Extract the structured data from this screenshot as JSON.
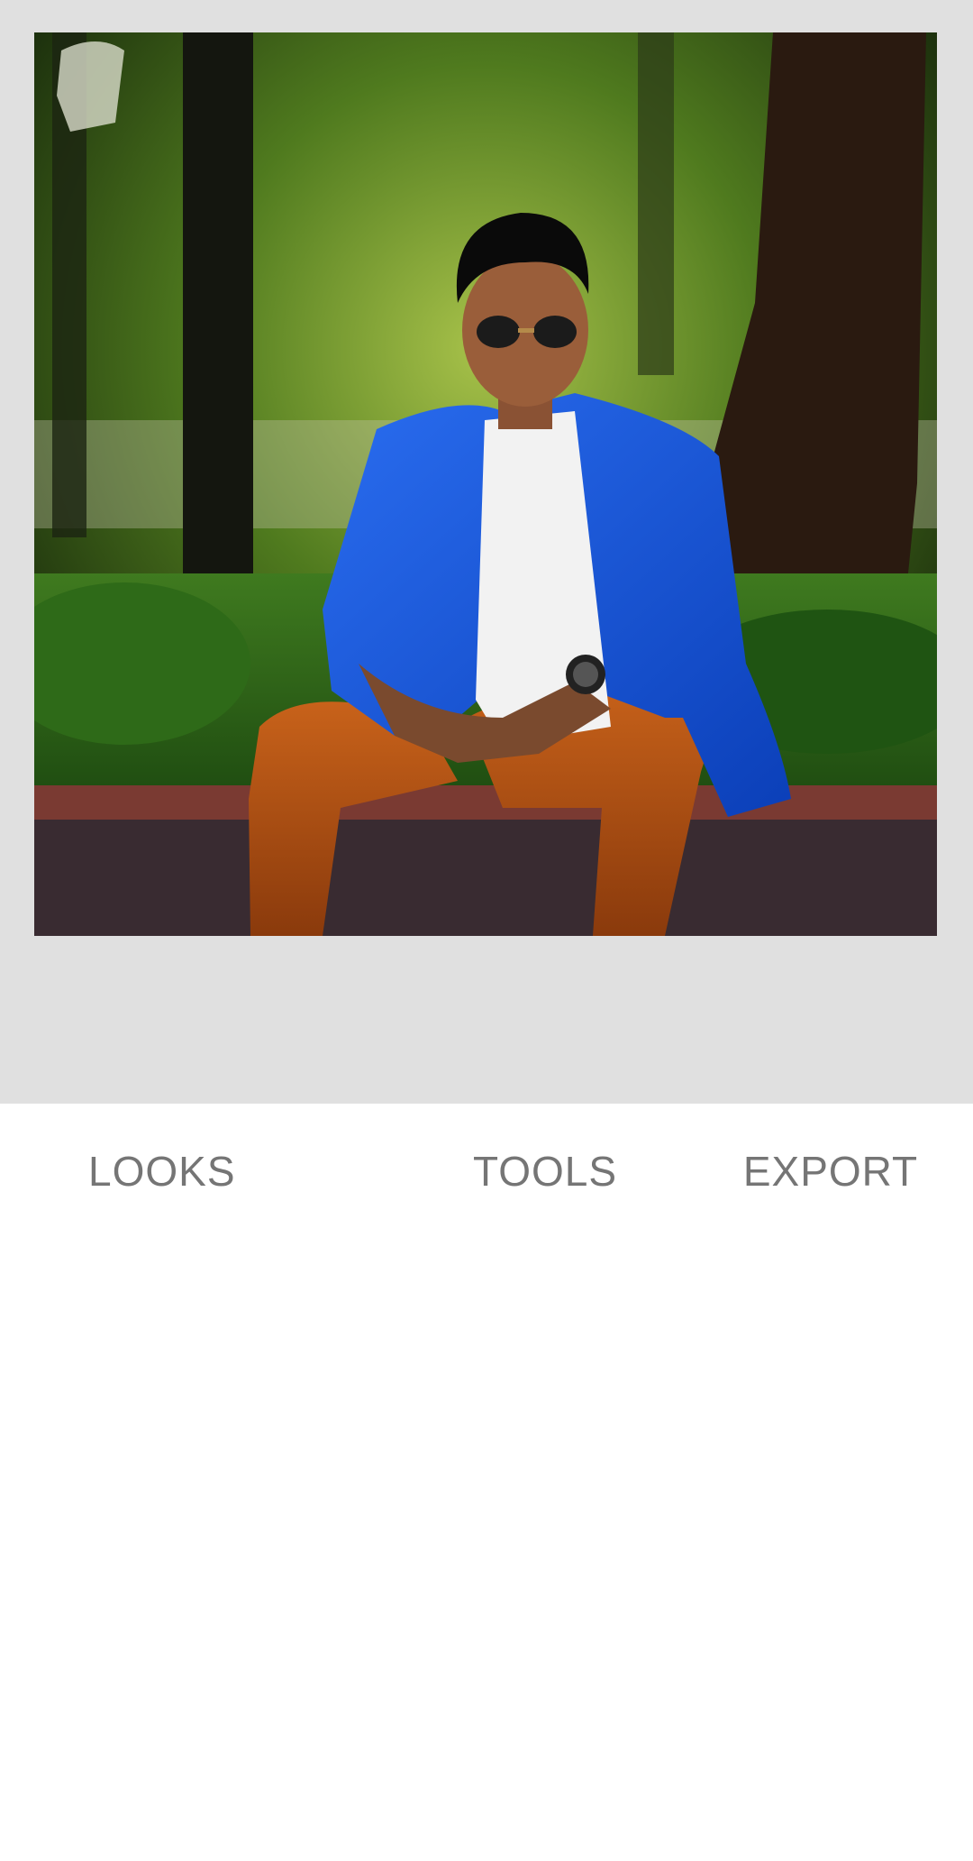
{
  "colors": {
    "canvas_background": "#e0e0e0",
    "panel_background": "#ffffff",
    "tab_text": "#757575"
  },
  "photo": {
    "description_icon": "photo-image"
  },
  "tabs": [
    {
      "label": "LOOKS"
    },
    {
      "label": "TOOLS"
    },
    {
      "label": "EXPORT"
    }
  ]
}
